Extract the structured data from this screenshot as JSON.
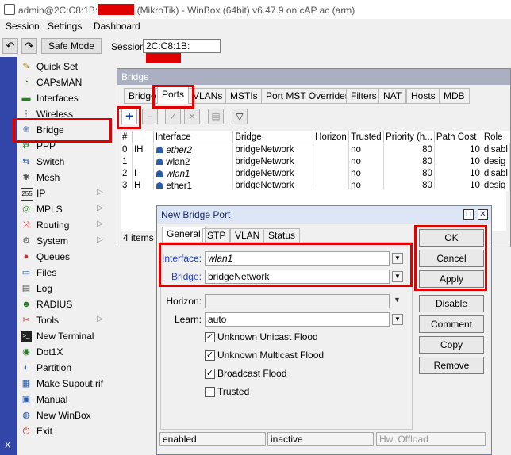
{
  "window": {
    "title_prefix": "admin@2C:C8:1B:",
    "title_suffix": " (MikroTik) - WinBox (64bit) v6.47.9 on cAP ac (arm)"
  },
  "menu": [
    "Session",
    "Settings",
    "Dashboard"
  ],
  "toolbar": {
    "safe_mode": "Safe Mode",
    "session_label": "Session:",
    "session_value": "2C:C8:1B:"
  },
  "nav": {
    "side_label": "X",
    "items": [
      {
        "label": "Quick Set",
        "icon": "quick-set-icon"
      },
      {
        "label": "CAPsMAN",
        "icon": "capsman-icon"
      },
      {
        "label": "Interfaces",
        "icon": "interfaces-icon"
      },
      {
        "label": "Wireless",
        "icon": "wireless-icon"
      },
      {
        "label": "Bridge",
        "icon": "bridge-icon"
      },
      {
        "label": "PPP",
        "icon": "ppp-icon"
      },
      {
        "label": "Switch",
        "icon": "switch-icon"
      },
      {
        "label": "Mesh",
        "icon": "mesh-icon"
      },
      {
        "label": "IP",
        "icon": "ip-icon"
      },
      {
        "label": "MPLS",
        "icon": "mpls-icon"
      },
      {
        "label": "Routing",
        "icon": "routing-icon"
      },
      {
        "label": "System",
        "icon": "system-icon"
      },
      {
        "label": "Queues",
        "icon": "queues-icon"
      },
      {
        "label": "Files",
        "icon": "files-icon"
      },
      {
        "label": "Log",
        "icon": "log-icon"
      },
      {
        "label": "RADIUS",
        "icon": "radius-icon"
      },
      {
        "label": "Tools",
        "icon": "tools-icon"
      },
      {
        "label": "New Terminal",
        "icon": "terminal-icon"
      },
      {
        "label": "Dot1X",
        "icon": "dot1x-icon"
      },
      {
        "label": "Partition",
        "icon": "partition-icon"
      },
      {
        "label": "Make Supout.rif",
        "icon": "supout-icon"
      },
      {
        "label": "Manual",
        "icon": "manual-icon"
      },
      {
        "label": "New WinBox",
        "icon": "winbox-icon"
      },
      {
        "label": "Exit",
        "icon": "exit-icon"
      }
    ]
  },
  "bridge_window": {
    "title": "Bridge",
    "tabs": [
      "Bridge",
      "Ports",
      "VLANs",
      "MSTIs",
      "Port MST Overrides",
      "Filters",
      "NAT",
      "Hosts",
      "MDB"
    ],
    "columns": [
      "#",
      "Interface",
      "Bridge",
      "Horizon",
      "Trusted",
      "Priority (h...",
      "Path Cost",
      "Role"
    ],
    "rows": [
      {
        "num": "0",
        "flags": "IH",
        "interface": "ether2",
        "bridge": "bridgeNetwork",
        "horizon": "",
        "trusted": "no",
        "priority": "80",
        "path_cost": "10",
        "role": "disabl"
      },
      {
        "num": "1",
        "flags": "",
        "interface": "wlan2",
        "bridge": "bridgeNetwork",
        "horizon": "",
        "trusted": "no",
        "priority": "80",
        "path_cost": "10",
        "role": "desig"
      },
      {
        "num": "2",
        "flags": "I",
        "interface": "wlan1",
        "bridge": "bridgeNetwork",
        "horizon": "",
        "trusted": "no",
        "priority": "80",
        "path_cost": "10",
        "role": "disabl"
      },
      {
        "num": "3",
        "flags": "H",
        "interface": "ether1",
        "bridge": "bridgeNetwork",
        "horizon": "",
        "trusted": "no",
        "priority": "80",
        "path_cost": "10",
        "role": "desig"
      }
    ],
    "count": "4 items"
  },
  "dialog": {
    "title": "New Bridge Port",
    "tabs": [
      "General",
      "STP",
      "VLAN",
      "Status"
    ],
    "interface_label": "Interface:",
    "interface_value": "wlan1",
    "bridge_label": "Bridge:",
    "bridge_value": "bridgeNetwork",
    "horizon_label": "Horizon:",
    "horizon_value": "",
    "learn_label": "Learn:",
    "learn_value": "auto",
    "checks": [
      {
        "label": "Unknown Unicast Flood",
        "checked": true
      },
      {
        "label": "Unknown Multicast Flood",
        "checked": true
      },
      {
        "label": "Broadcast Flood",
        "checked": true
      },
      {
        "label": "Trusted",
        "checked": false
      }
    ],
    "buttons": [
      "OK",
      "Cancel",
      "Apply",
      "Disable",
      "Comment",
      "Copy",
      "Remove"
    ],
    "status": [
      "enabled",
      "inactive",
      "Hw. Offload"
    ]
  },
  "colors": {
    "highlight": "#e00000",
    "sidebar": "#3146a8",
    "field_label_blue": "#1f3fbf"
  }
}
